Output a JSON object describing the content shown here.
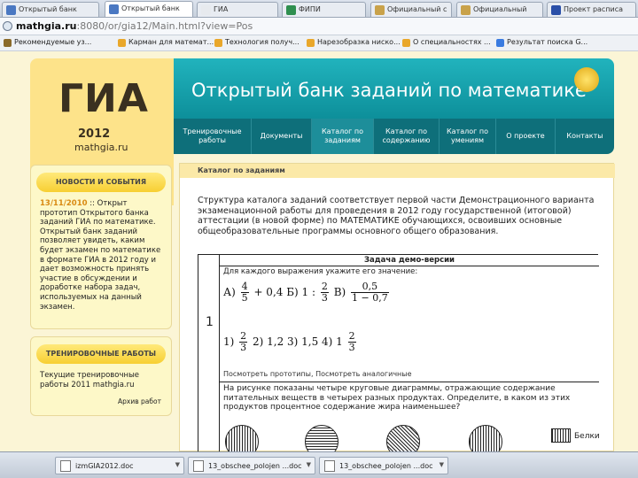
{
  "browser": {
    "tabs": [
      "Открытый банк",
      "Открытый банк",
      "ГИА",
      "ФИПИ",
      "Официальный с",
      "Официальный",
      "Проект расписа"
    ],
    "url_host": "mathgia.ru",
    "url_path": ":8080/or/gia12/Main.html?view=Pos",
    "bookmarks": [
      "Рекомендуемые уз...",
      "Карман для математ...",
      "Технология получ...",
      "Нарезобразка ниско...",
      "О специальностях ...",
      "Результат поиска G..."
    ]
  },
  "site": {
    "logo_title": "ГИА",
    "logo_year": "2012",
    "logo_site": "mathgia.ru",
    "banner_title": "Открытый банк заданий по математике",
    "menu": [
      "Тренировочные работы",
      "Документы",
      "Каталог по заданиям",
      "Каталог по содержанию",
      "Каталог по умениям",
      "О проекте",
      "Контакты"
    ]
  },
  "sidebar": {
    "news_heading": "НОВОСТИ И СОБЫТИЯ",
    "news_date": "13/11/2010",
    "news_text": ":: Открыт прототип Открытого банка заданий ГИА по математике. Открытый банк заданий позволяет увидеть, каким будет экзамен по математике в формате ГИА в 2012 году и дает возможность принять участие в обсуждении и доработке набора задач, используемых на данный экзамен.",
    "work_heading": "ТРЕНИРОВОЧНЫЕ РАБОТЫ",
    "work_text": "Текущие тренировочные работы 2011 mathgia.ru",
    "work_archive": "Архив работ"
  },
  "main": {
    "heading": "Каталог по заданиям",
    "intro": "Структура каталога заданий соответствует первой части Демонстрационного варианта экзаменационной работы для проведения в 2012 году государственной (итоговой) аттестации (в новой форме) по МАТЕМАТИКЕ обучающихся, освоивших основные общеобразовательные программы основного общего образования.",
    "table_header": "Задача демо-версии",
    "task_number": "1",
    "task1_prompt": "Для каждого выражения укажите его значение:",
    "expr_a_label": "А)",
    "expr_a_n1": "4",
    "expr_a_d1": "5",
    "expr_a_rest": "+ 0,4",
    "expr_b_label": "Б) 1 :",
    "expr_b_n": "2",
    "expr_b_d": "3",
    "expr_c_label": "В)",
    "expr_c_n": "0,5",
    "expr_c_d": "1 − 0,7",
    "ans_1_prefix": "1)",
    "ans_1_n": "2",
    "ans_1_d": "3",
    "ans_rest": "2) 1,2  3) 1,5  4) 1",
    "ans_4_n": "2",
    "ans_4_d": "3",
    "task_links": "Посмотреть прототипы, Посмотреть аналогичные",
    "task2_text": "На рисунке показаны четыре круговые диаграммы, отражающие содержание питательных веществ в четырех разных продуктах. Определите, в каком из этих продуктов процентное содержание жира наименьшее?",
    "legend_label": "Белки"
  },
  "taskbar": {
    "items": [
      "izmGIA2012.doc",
      "13_obschee_polojen ...doc",
      "13_obschee_polojen ...doc"
    ]
  }
}
